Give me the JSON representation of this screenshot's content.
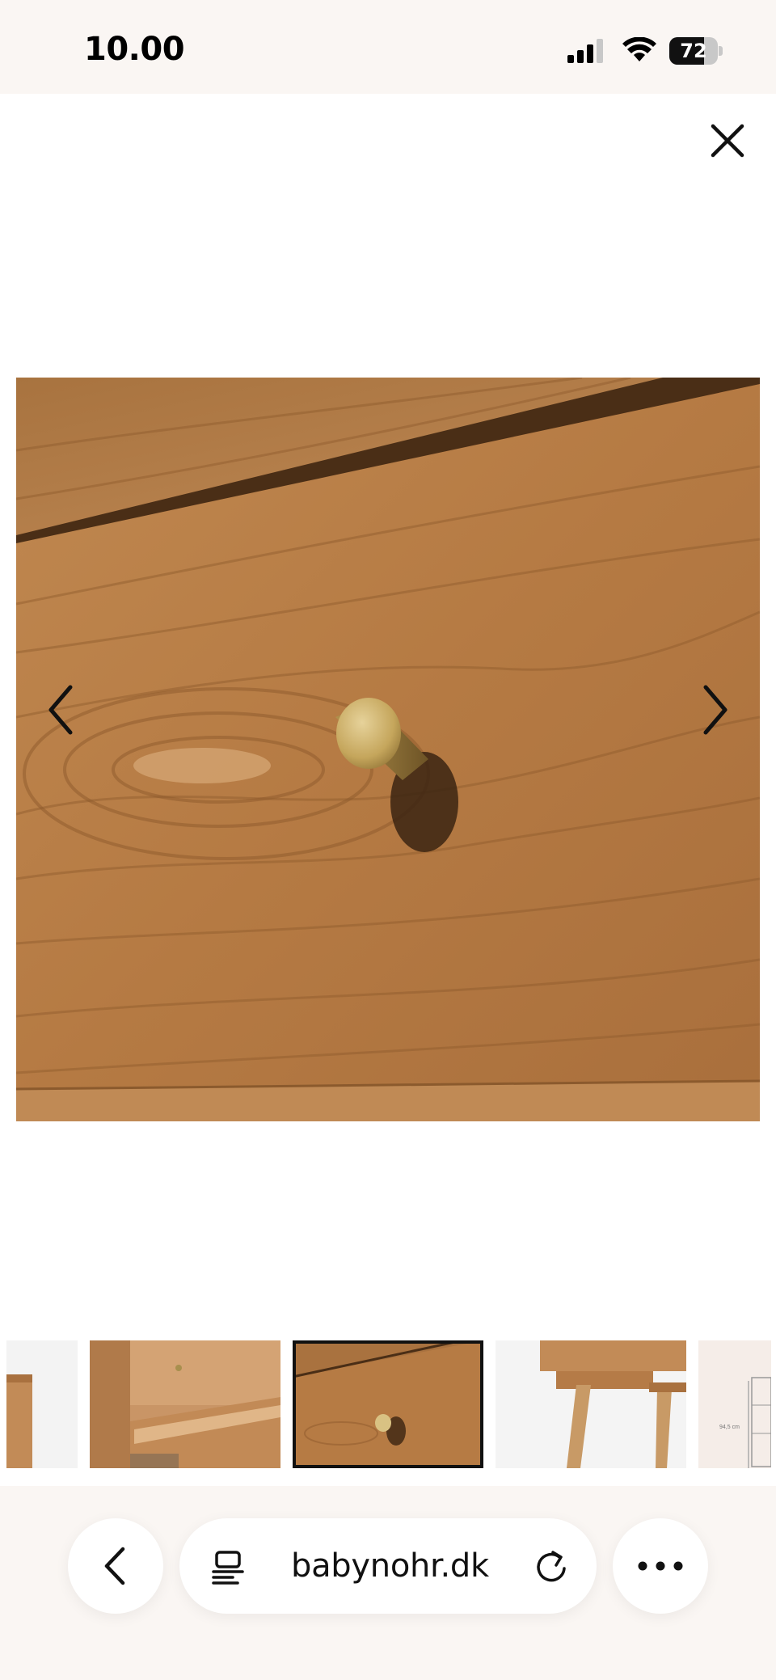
{
  "status_bar": {
    "time": "10.00",
    "battery_percent": "72",
    "battery_level": 0.72,
    "icons": [
      "signal-icon",
      "wifi-icon",
      "battery-icon"
    ]
  },
  "viewer": {
    "close_icon": "close-icon",
    "prev_icon": "chevron-left-icon",
    "next_icon": "chevron-right-icon",
    "thumbnail_count_visible": 5,
    "selected_thumbnail_index": 2
  },
  "thumbnails": {
    "items": [
      {
        "name": "thumb-partial-left"
      },
      {
        "name": "thumb-open-drawer"
      },
      {
        "name": "thumb-drawer-knob"
      },
      {
        "name": "thumb-legs"
      },
      {
        "name": "thumb-dimensions",
        "label": "94,5 cm"
      }
    ]
  },
  "browser": {
    "url": "babynohr.dk",
    "back_icon": "chevron-left-icon",
    "tabs_icon": "tabs-icon",
    "reload_icon": "reload-icon",
    "more_icon": "more-icon"
  },
  "colors": {
    "chrome_bg": "#faf6f3",
    "wood_base": "#b77d4a",
    "brass_knob": "#c9a85c"
  }
}
